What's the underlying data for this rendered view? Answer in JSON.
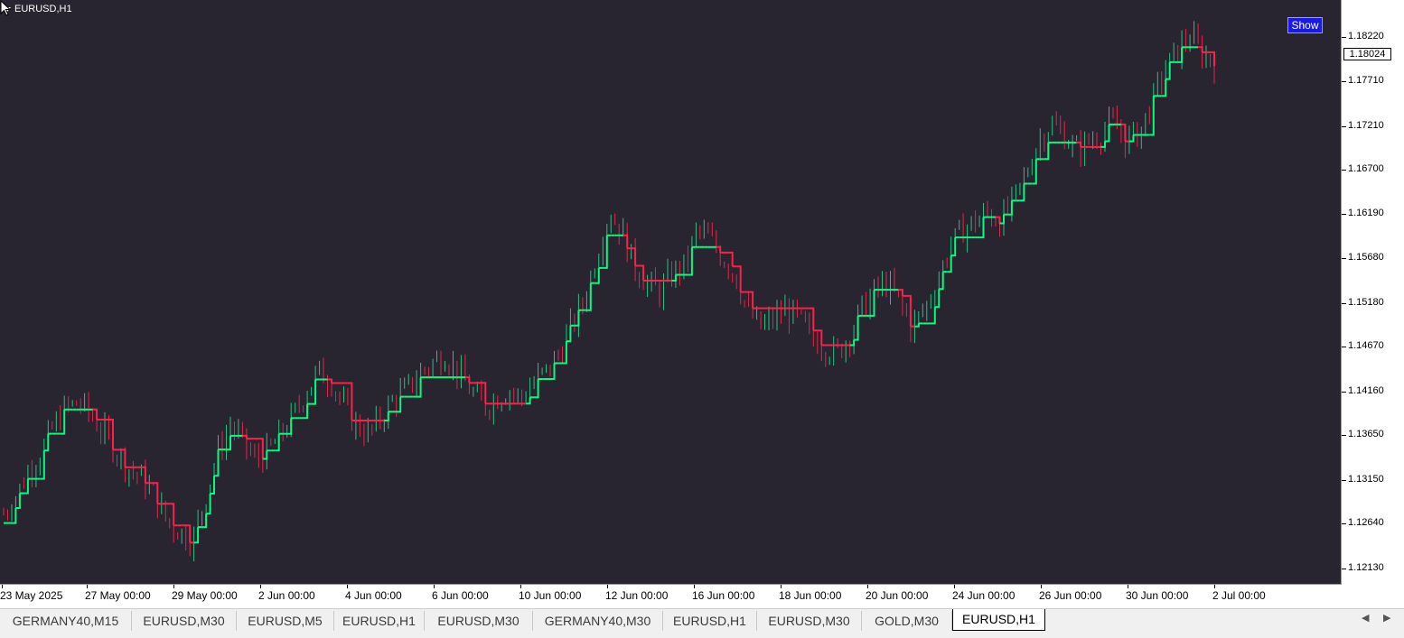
{
  "window": {
    "symbol_label": "EURUSD,H1"
  },
  "show_button": {
    "label": "Show"
  },
  "price_axis": {
    "labels": [
      "1.18220",
      "1.17710",
      "1.17210",
      "1.16700",
      "1.16190",
      "1.15680",
      "1.15180",
      "1.14670",
      "1.14160",
      "1.13650",
      "1.13150",
      "1.12640",
      "1.12130"
    ],
    "current_price": "1.18024"
  },
  "time_axis": {
    "labels": [
      "23 May 2025",
      "27 May 00:00",
      "29 May 00:00",
      "2 Jun 00:00",
      "4 Jun 00:00",
      "6 Jun 00:00",
      "10 Jun 00:00",
      "12 Jun 00:00",
      "16 Jun 00:00",
      "18 Jun 00:00",
      "20 Jun 00:00",
      "24 Jun 00:00",
      "26 Jun 00:00",
      "30 Jun 00:00",
      "2 Jul 00:00"
    ]
  },
  "tabs": [
    {
      "label": "GERMANY40,M15",
      "active": false
    },
    {
      "label": "EURUSD,M30",
      "active": false
    },
    {
      "label": "EURUSD,M5",
      "active": false
    },
    {
      "label": "EURUSD,H1",
      "active": false
    },
    {
      "label": "EURUSD,M30",
      "active": false
    },
    {
      "label": "GERMANY40,M30",
      "active": false
    },
    {
      "label": "EURUSD,H1",
      "active": false
    },
    {
      "label": "EURUSD,M30",
      "active": false
    },
    {
      "label": "GOLD,M30",
      "active": false
    },
    {
      "label": "EURUSD,H1",
      "active": true
    }
  ],
  "tab_nav": {
    "left_icon": "chevron-left-icon",
    "right_icon": "chevron-right-icon"
  },
  "colors": {
    "background": "#292530",
    "bull": "#26c281",
    "bear": "#e0264a",
    "trend_up": "#00ff7f",
    "trend_down": "#ff1f4b"
  },
  "chart_data": {
    "type": "line",
    "series": [
      {
        "values": [
          1.128,
          1.13,
          1.133,
          1.135,
          1.138,
          1.14,
          1.1405,
          1.139,
          1.137,
          1.135,
          1.133,
          1.132,
          1.13,
          1.127,
          1.126,
          1.125,
          1.13,
          1.135,
          1.138,
          1.136,
          1.134,
          1.135,
          1.137,
          1.139,
          1.142,
          1.144,
          1.143,
          1.14,
          1.138,
          1.137,
          1.139,
          1.141,
          1.142,
          1.144,
          1.145,
          1.146,
          1.144,
          1.142,
          1.14,
          1.141,
          1.142,
          1.141,
          1.143,
          1.144,
          1.146,
          1.149,
          1.152,
          1.157,
          1.162,
          1.16,
          1.156,
          1.154,
          1.153,
          1.155,
          1.156,
          1.16,
          1.159,
          1.157,
          1.155,
          1.151,
          1.149,
          1.15,
          1.151,
          1.15,
          1.148,
          1.147,
          1.146,
          1.148,
          1.151,
          1.153,
          1.154,
          1.152,
          1.149,
          1.151,
          1.154,
          1.158,
          1.16,
          1.161,
          1.162,
          1.161,
          1.163,
          1.166,
          1.17,
          1.172,
          1.171,
          1.169,
          1.17,
          1.171,
          1.172,
          1.17,
          1.171,
          1.174,
          1.178,
          1.18,
          1.182,
          1.18,
          1.179
        ]
      }
    ],
    "ylim": [
      1.12,
      1.186
    ]
  }
}
